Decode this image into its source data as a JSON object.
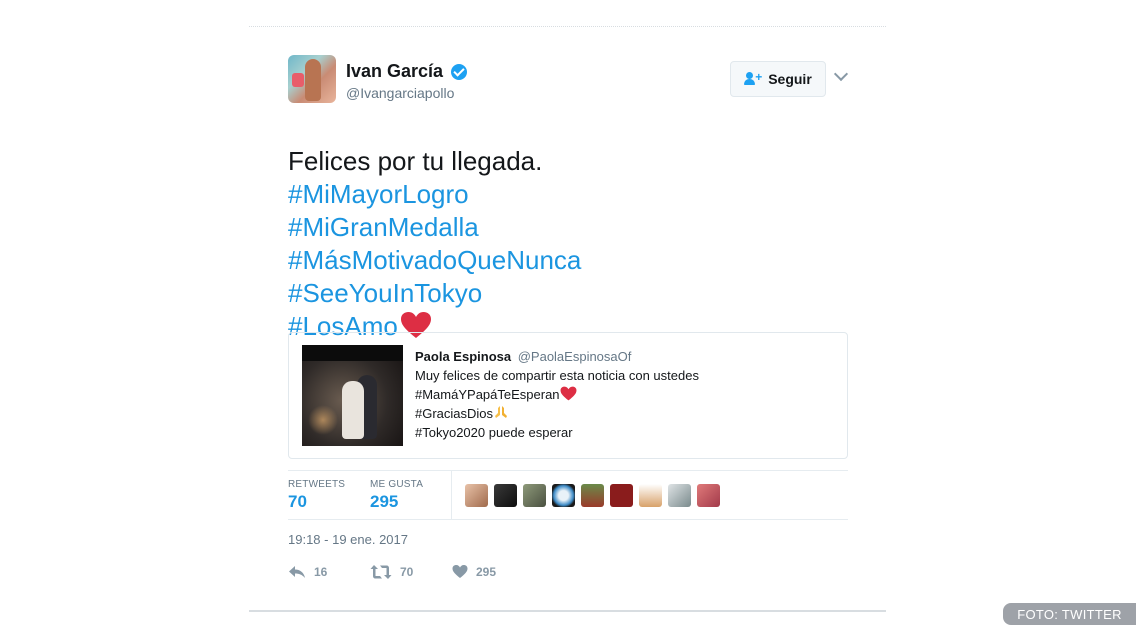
{
  "tweet": {
    "display_name": "Ivan García",
    "handle": "@Ivangarciapollo",
    "follow_label": "Seguir",
    "text_lines": [
      "Felices por tu llegada.",
      "#MiMayorLogro",
      "#MiGranMedalla",
      "#MásMotivadoQueNunca",
      "#SeeYouInTokyo",
      "#LosAmo"
    ],
    "timestamp": "19:18 - 19 ene. 2017"
  },
  "quote": {
    "name": "Paola Espinosa",
    "handle": "@PaolaEspinosaOf",
    "lines": [
      "Muy felices de compartir esta noticia con ustedes",
      "#MamáYPapáTeEsperan",
      "#GraciasDios",
      "#Tokyo2020 puede esperar"
    ]
  },
  "stats": {
    "retweets_label": "RETWEETS",
    "retweets_value": "70",
    "likes_label": "ME GUSTA",
    "likes_value": "295"
  },
  "actions": {
    "reply_count": "16",
    "retweet_count": "70",
    "like_count": "295"
  },
  "colors": {
    "link": "#1b95e0",
    "verified": "#1da1f2",
    "heart": "#e0245e"
  },
  "icons": [
    "verified-badge-icon",
    "follow-person-icon",
    "chevron-down-icon",
    "reply-icon",
    "retweet-icon",
    "heart-icon"
  ],
  "photo_credit": "FOTO: TWITTER"
}
